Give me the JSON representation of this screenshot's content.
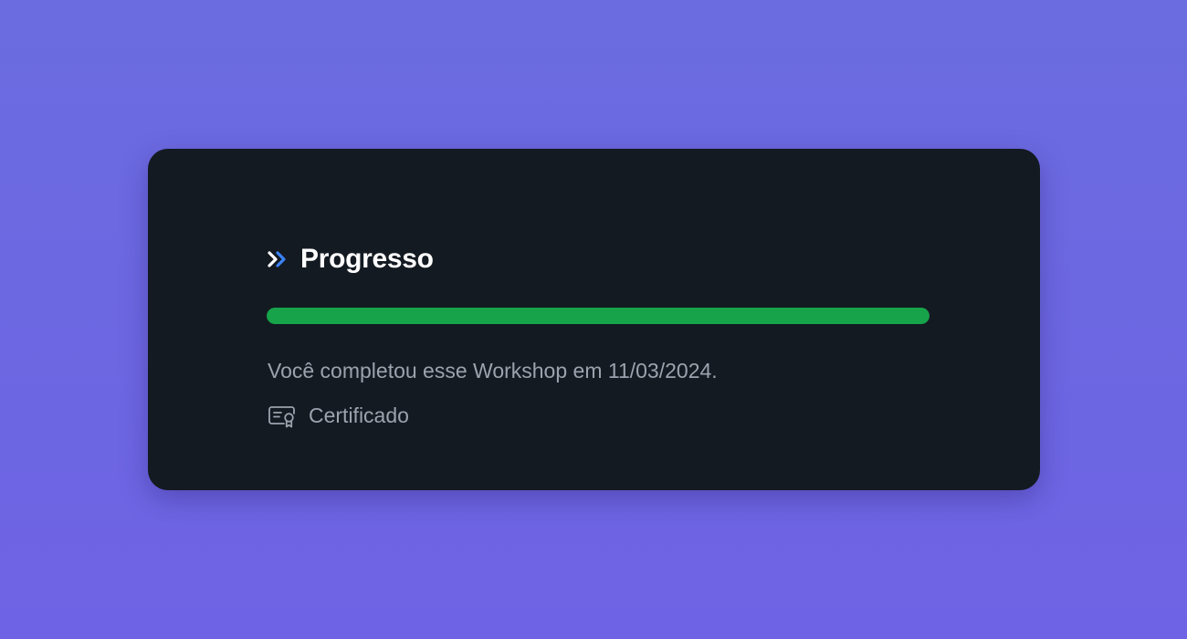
{
  "card": {
    "title": "Progresso",
    "title_icon": "double-chevron-right-icon",
    "progress": {
      "percent": 100,
      "fill_color": "#16a34a"
    },
    "completion_text": "Você completou esse Workshop em 11/03/2024.",
    "certificate": {
      "label": "Certificado",
      "icon": "certificate-icon"
    }
  },
  "colors": {
    "background": "#6b6ce0",
    "card": "#131a21",
    "accent_blue": "#3b82f6",
    "muted_text": "#9ba3ae"
  }
}
